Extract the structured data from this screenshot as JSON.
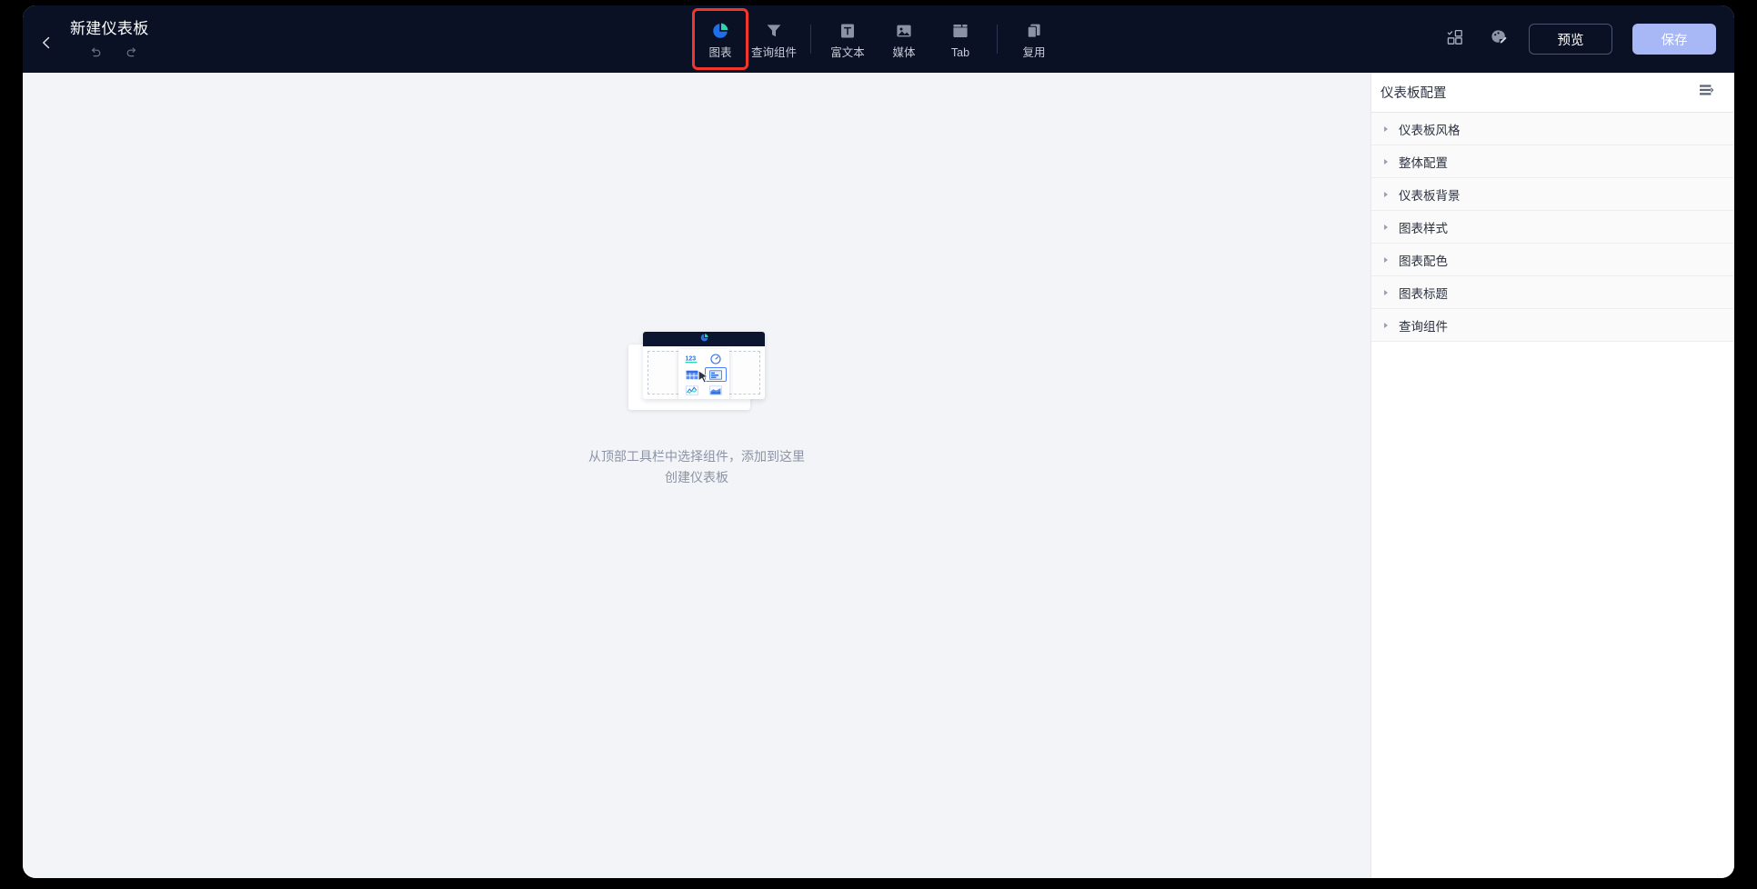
{
  "window": {
    "background": "#000000",
    "canvas_bg": "#f2f4f7",
    "topbar_bg": "#0a1124",
    "accent": "#a8b7f5",
    "highlight": "#f3352e"
  },
  "topbar": {
    "back_icon": "chevron-left-icon",
    "title": "新建仪表板",
    "undo_icon": "undo-icon",
    "redo_icon": "redo-icon",
    "tools": [
      {
        "label": "图表",
        "icon": "pie-chart-icon",
        "highlighted": true,
        "divider_after": false
      },
      {
        "label": "查询组件",
        "icon": "filter-funnel-icon",
        "highlighted": false,
        "divider_after": true
      },
      {
        "label": "富文本",
        "icon": "rich-text-icon",
        "highlighted": false,
        "divider_after": false
      },
      {
        "label": "媒体",
        "icon": "media-image-icon",
        "highlighted": false,
        "divider_after": false
      },
      {
        "label": "Tab",
        "icon": "tab-window-icon",
        "highlighted": false,
        "divider_after": true
      },
      {
        "label": "复用",
        "icon": "duplicate-icon",
        "highlighted": false,
        "divider_after": false
      }
    ],
    "layout_icon": "layout-grid-icon",
    "theme_icon": "palette-icon",
    "preview_label": "预览",
    "save_label": "保存"
  },
  "canvas": {
    "empty_state": {
      "line1": "从顶部工具栏中选择组件，添加到这里",
      "line2": "创建仪表板",
      "illustration": {
        "header_icon": "pie-chart-icon",
        "picker_icons": [
          "number-123-icon",
          "gauge-icon",
          "table-icon",
          "bar-list-icon",
          "line-chart-icon",
          "area-chart-icon"
        ],
        "selected_index": 3,
        "cursor_icon": "mouse-pointer-icon"
      }
    }
  },
  "config_panel": {
    "title": "仪表板配置",
    "menu_icon": "list-menu-icon",
    "sections": [
      {
        "label": "仪表板风格"
      },
      {
        "label": "整体配置"
      },
      {
        "label": "仪表板背景"
      },
      {
        "label": "图表样式"
      },
      {
        "label": "图表配色"
      },
      {
        "label": "图表标题"
      },
      {
        "label": "查询组件"
      }
    ]
  }
}
